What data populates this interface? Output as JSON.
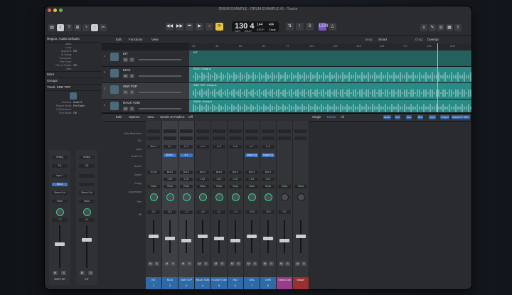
{
  "window": {
    "title": "DRUM EXAMPLE - DRUM EXAMPLE #1 - Tracks"
  },
  "control_bar": {
    "lcd": {
      "bar_beat": "130 4",
      "bar_label": "BAR",
      "beat_label": "BEAT",
      "tempo": "144",
      "tempo_label": "KEEP",
      "sig": "4/4",
      "key": "Cmaj"
    }
  },
  "inspector": {
    "region_header": "Region: Audio Defaults",
    "region_rows": [
      {
        "k": "Mute:",
        "v": ""
      },
      {
        "k": "Loop:",
        "v": ""
      },
      {
        "k": "Quantize:",
        "v": "Off"
      },
      {
        "k": "Q-Swing:",
        "v": ""
      },
      {
        "k": "Transpose:",
        "v": ""
      },
      {
        "k": "Fine Tune:",
        "v": ""
      },
      {
        "k": "Flex & Follow:",
        "v": "Off"
      },
      {
        "k": "Gain:",
        "v": ""
      }
    ],
    "more": "More",
    "groups": "Groups",
    "track_header": "Track: SNR TOP",
    "track_rows": [
      {
        "k": "Channel:",
        "v": "Audio 5"
      },
      {
        "k": "Freeze Mode:",
        "v": "Pre Fader"
      },
      {
        "k": "Q-Reference:",
        "v": ""
      },
      {
        "k": "Flex Mode:",
        "v": "Off"
      }
    ],
    "strip1": {
      "setting": "Setting",
      "eq": "EQ",
      "input": "Input 1",
      "sends": "Bus 4",
      "output": "Stereo Out",
      "read": "Read",
      "vol": "-7.2",
      "name": "SNR TOP"
    },
    "strip2": {
      "setting": "Setting",
      "eq": "EQ",
      "input": "",
      "sends": "",
      "output": "Stereo Out",
      "read": "Read",
      "vol": "0.0",
      "name": "KIT"
    }
  },
  "tracks_area": {
    "edit": "Edit",
    "functions": "Functions",
    "view": "View",
    "snap_label": "Snap:",
    "snap_value": "Smart",
    "drag_label": "Drag:",
    "drag_value": "Overlap",
    "ruler": [
      "33",
      "49",
      "65",
      "81",
      "97",
      "113",
      "129",
      "145",
      "161",
      "177",
      "193",
      "209"
    ],
    "tracks": [
      {
        "num": "1",
        "name": "KIT",
        "region": "KIT"
      },
      {
        "num": "2",
        "name": "KICK",
        "region": "KICK: Comp A"
      },
      {
        "num": "3",
        "name": "SNR TOP",
        "region": "SNR TOP: Comp A"
      },
      {
        "num": "4",
        "name": "RACK TOM",
        "region": "RACK: Comp A"
      }
    ]
  },
  "mixer": {
    "edit": "Edit",
    "options": "Options",
    "view": "View",
    "sends_on_faders": "Sends on Faders:",
    "sends_value": "Off",
    "mode_tabs": [
      "Single",
      "Tracks",
      "All"
    ],
    "filters": [
      "Audio",
      "Inst",
      "Aux",
      "Bus",
      "Input",
      "Output",
      "Master/VCA",
      "MIDI"
    ],
    "row_labels": [
      "Gain Reduction",
      "EQ",
      "Input",
      "Audio FX",
      "Sends",
      "Output",
      "Group",
      "Automation",
      "Pan",
      "dB"
    ],
    "strips": [
      {
        "name": "KIT",
        "num": "1",
        "input": "Bus 4",
        "fx": "",
        "output": "St Out",
        "group": "",
        "auto": "Read",
        "vol": "0.0",
        "color": "#2f6aa8"
      },
      {
        "name": "KICK",
        "num": "2",
        "input": "In 1",
        "fx": "SEmin...",
        "output": "Bus 4",
        "group": "1 KIT",
        "auto": "Read",
        "vol": "-8.1",
        "color": "#2f6aa8"
      },
      {
        "name": "SNR TOP",
        "num": "3",
        "input": "In 2",
        "fx": "B 2",
        "output": "Bus 4",
        "group": "1 KIT",
        "auto": "Read",
        "vol": "-7.2",
        "color": "#2f6aa8"
      },
      {
        "name": "RACK TOM",
        "num": "4",
        "input": "In 4",
        "fx": "",
        "output": "Bus 4",
        "group": "1 KIT",
        "auto": "Read",
        "vol": "-4.0",
        "color": "#2f6aa8"
      },
      {
        "name": "FLOOR TOM",
        "num": "5",
        "input": "In 5",
        "fx": "",
        "output": "Bus 4",
        "group": "1 KIT",
        "auto": "Read",
        "vol": "3.1",
        "color": "#2f6aa8"
      },
      {
        "name": "HAT",
        "num": "6",
        "input": "In 6",
        "fx": "",
        "output": "Bus 4",
        "group": "1 KIT",
        "auto": "Read",
        "vol": "-2.4",
        "color": "#2f6aa8"
      },
      {
        "name": "OHL",
        "num": "7",
        "input": "In 7",
        "fx": "Single EQ",
        "output": "Bus 4",
        "group": "1 KIT",
        "auto": "Read",
        "vol": "-10.0",
        "color": "#2f6aa8"
      },
      {
        "name": "OHR",
        "num": "8",
        "input": "In 8",
        "fx": "Single EQ",
        "output": "Bus 4",
        "group": "1 KIT",
        "auto": "Read",
        "vol": "-10.0",
        "color": "#2f6aa8"
      },
      {
        "name": "Stereo Out",
        "num": "",
        "input": "",
        "fx": "",
        "output": "",
        "group": "",
        "auto": "Read",
        "vol": "0.0",
        "color": "#9a3a8a"
      },
      {
        "name": "Master",
        "num": "",
        "input": "",
        "fx": "",
        "output": "",
        "group": "",
        "auto": "Read",
        "vol": "",
        "color": "#9a3030"
      }
    ]
  },
  "colors": {
    "accent": "#3c76c9",
    "region": "#2a8a85",
    "playhead": "#e8c340",
    "record": "#e0453d",
    "cycle": "#e8c340"
  }
}
